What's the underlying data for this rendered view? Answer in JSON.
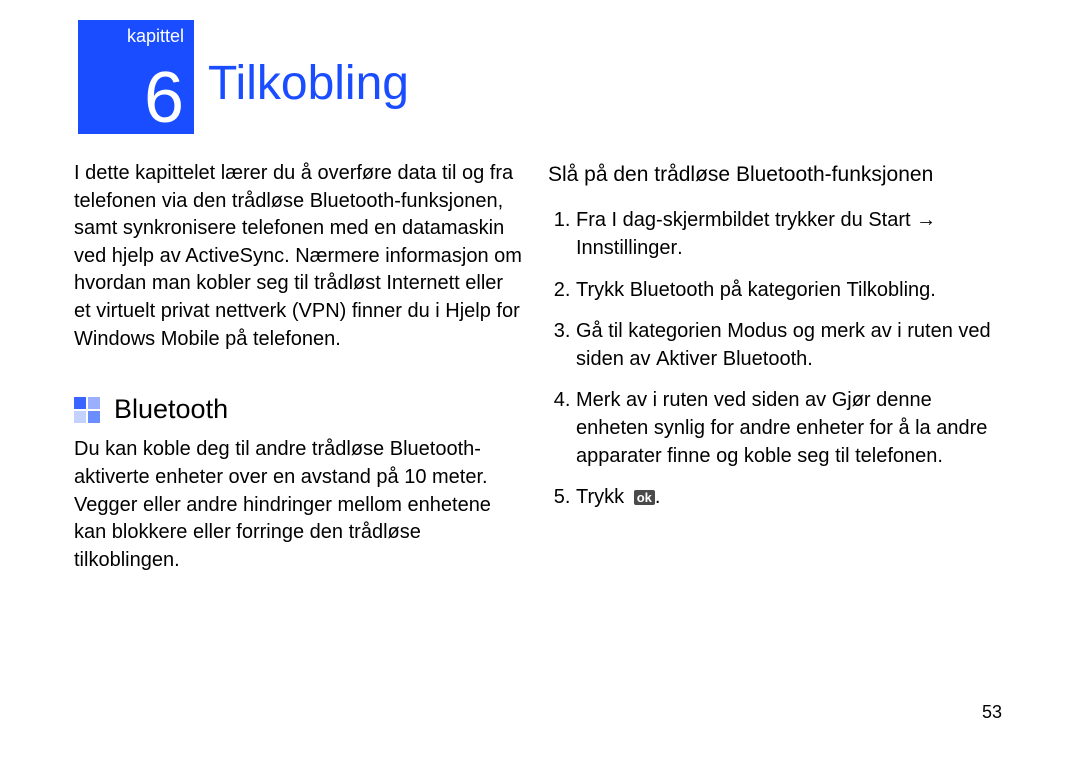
{
  "chapter": {
    "label": "kapittel",
    "number": "6",
    "title": "Tilkobling"
  },
  "intro": "I dette kapittelet lærer du å overføre data til og fra telefonen via den trådløse Bluetooth-funksjonen, samt synkronisere telefonen med en datamaskin ved hjelp av ActiveSync. Nærmere informasjon om hvordan man kobler seg til trådløst Internett eller et virtuelt privat nettverk (VPN) finner du i Hjelp for Windows Mobile på telefonen.",
  "section1": {
    "heading": "Bluetooth",
    "body": "Du kan koble deg til andre trådløse Bluetooth-aktiverte enheter over en avstand på 10 meter. Vegger eller andre hindringer mellom enhetene kan blokkere eller forringe den trådløse tilkoblingen."
  },
  "section2": {
    "heading": "Slå på den trådløse Bluetooth-funksjonen",
    "steps": {
      "s1_a": "Fra I dag-skjermbildet trykker du ",
      "s1_start": "Start",
      "s1_arrow": " → ",
      "s1_inst": "Innstillinger",
      "s1_end": ".",
      "s2_a": "Trykk ",
      "s2_bt": "Bluetooth",
      "s2_mid": " på kategorien ",
      "s2_tk": "Tilkobling",
      "s2_end": ".",
      "s3_a": "Gå til kategorien ",
      "s3_modus": "Modus",
      "s3_mid": " og merk av i ruten ved siden av ",
      "s3_akt": "Aktiver Bluetooth",
      "s3_end": ".",
      "s4_a": "Merk av i ruten ved siden av ",
      "s4_vis": "Gjør denne enheten synlig for andre enheter",
      "s4_end": " for å la andre apparater finne og koble seg til telefonen.",
      "s5_a": "Trykk ",
      "s5_ok": "ok",
      "s5_end": "."
    }
  },
  "page_number": "53"
}
